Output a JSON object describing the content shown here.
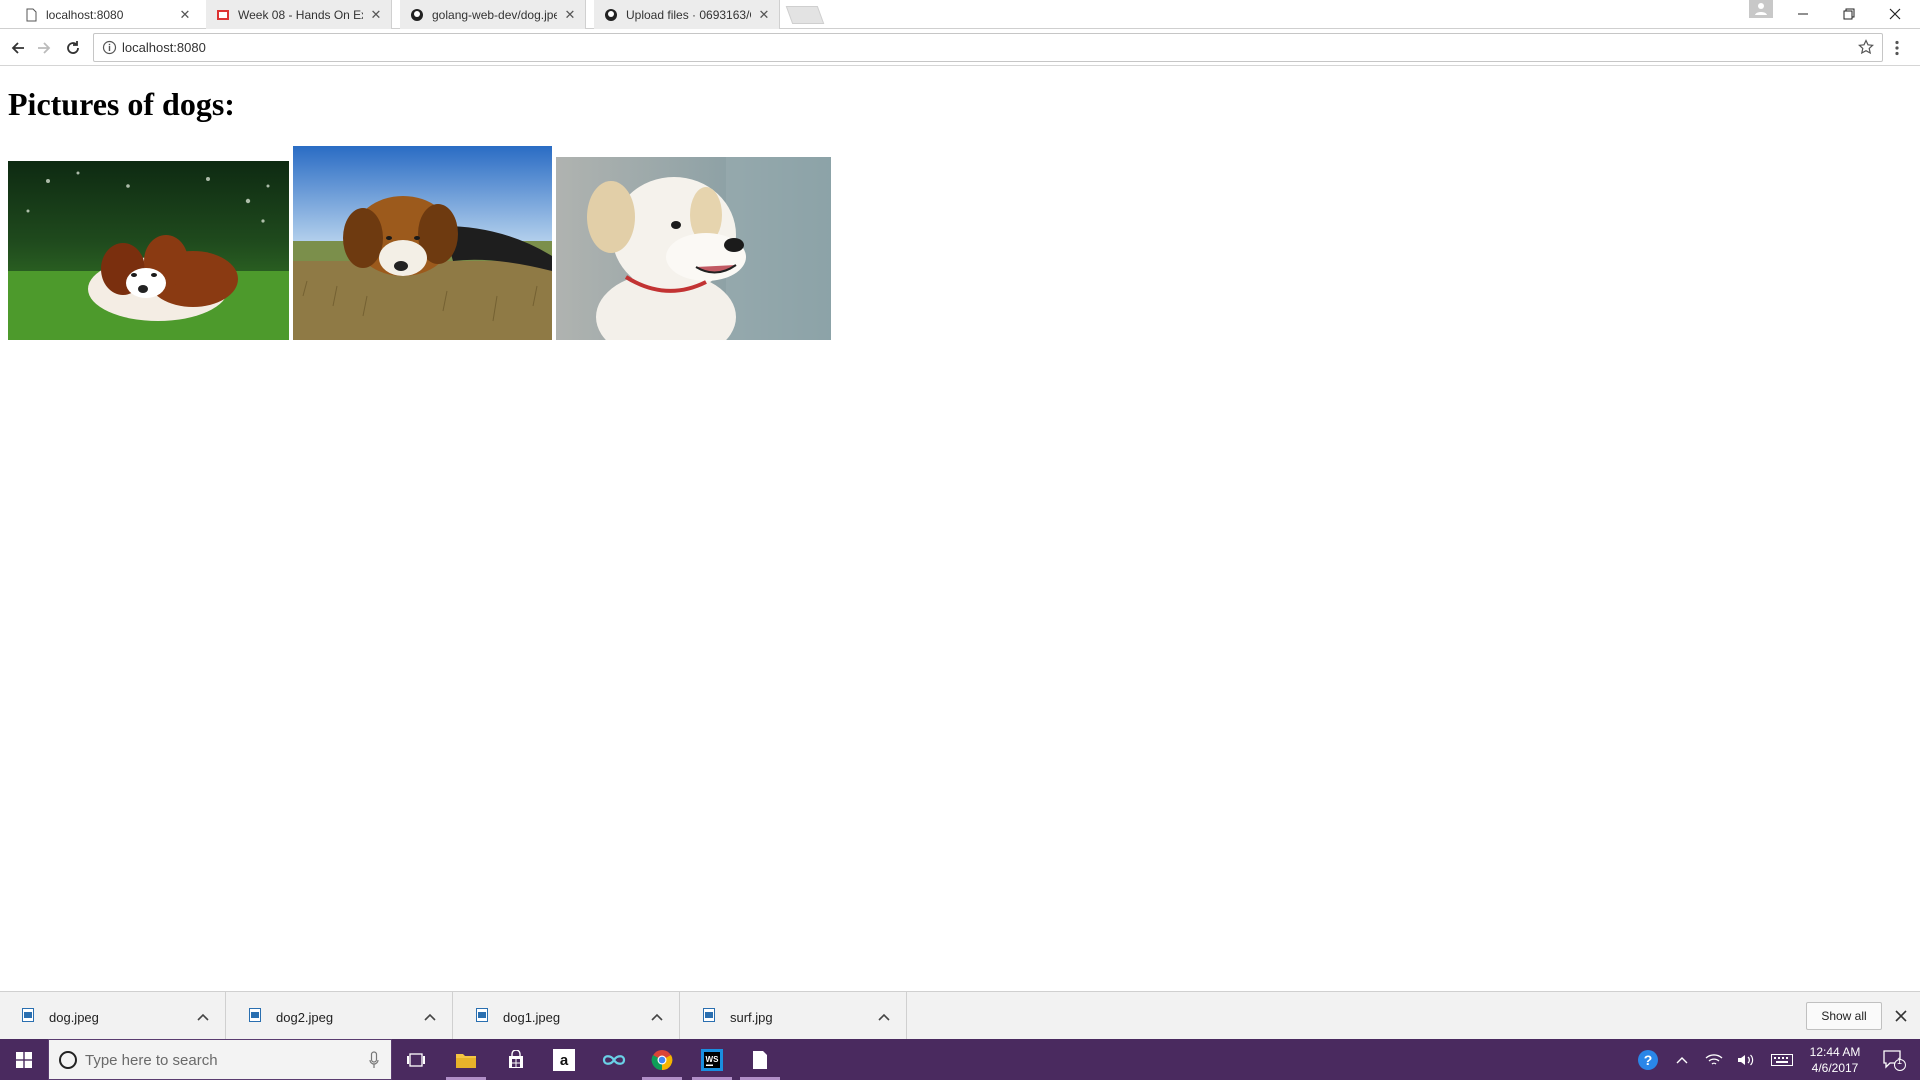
{
  "browser": {
    "tabs": [
      {
        "title": "localhost:8080",
        "active": true,
        "favicon": "page-icon"
      },
      {
        "title": "Week 08 - Hands On Exe",
        "active": false,
        "favicon": "slides-icon"
      },
      {
        "title": "golang-web-dev/dog.jpe",
        "active": false,
        "favicon": "github-icon"
      },
      {
        "title": "Upload files · 0693163/G",
        "active": false,
        "favicon": "github-icon"
      }
    ],
    "address": "localhost:8080"
  },
  "page": {
    "heading": "Pictures of dogs:",
    "images": [
      {
        "alt": "cavalier-spaniel-on-grass"
      },
      {
        "alt": "beagle-on-field"
      },
      {
        "alt": "white-puppy"
      }
    ]
  },
  "downloads": {
    "items": [
      "dog.jpeg",
      "dog2.jpeg",
      "dog1.jpeg",
      "surf.jpg"
    ],
    "show_all": "Show all"
  },
  "taskbar": {
    "search_placeholder": "Type here to search",
    "time": "12:44 AM",
    "date": "4/6/2017",
    "notification_count": "1"
  },
  "colors": {
    "taskbar": "#4a2a5f",
    "accent": "#b18fc8"
  }
}
